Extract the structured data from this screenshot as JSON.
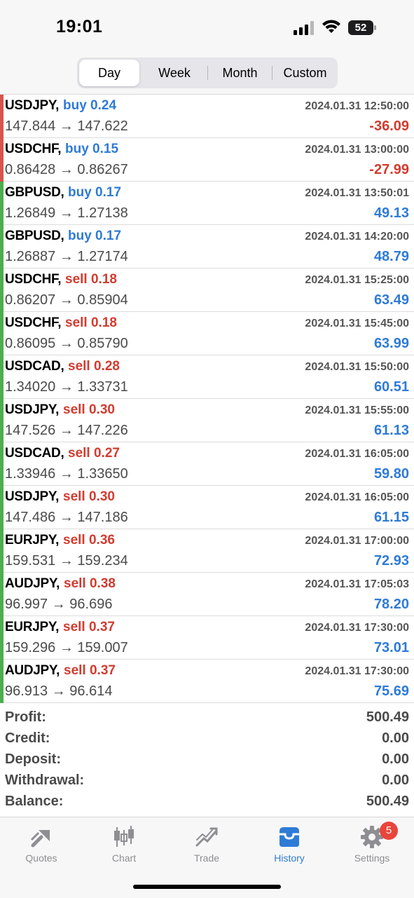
{
  "status": {
    "time": "19:01",
    "battery": "52"
  },
  "segments": [
    "Day",
    "Week",
    "Month",
    "Custom"
  ],
  "trades": [
    {
      "symbol": "USDJPY,",
      "side": "buy 0.24",
      "type": "buy",
      "price": "147.844 → 147.622",
      "time": "2024.01.31 12:50:00",
      "pl": "-36.09",
      "neg": true
    },
    {
      "symbol": "USDCHF,",
      "side": "buy 0.15",
      "type": "buy",
      "price": "0.86428 → 0.86267",
      "time": "2024.01.31 13:00:00",
      "pl": "-27.99",
      "neg": true
    },
    {
      "symbol": "GBPUSD,",
      "side": "buy 0.17",
      "type": "buy",
      "price": "1.26849 → 1.27138",
      "time": "2024.01.31 13:50:01",
      "pl": "49.13",
      "neg": false
    },
    {
      "symbol": "GBPUSD,",
      "side": "buy 0.17",
      "type": "buy",
      "price": "1.26887 → 1.27174",
      "time": "2024.01.31 14:20:00",
      "pl": "48.79",
      "neg": false
    },
    {
      "symbol": "USDCHF,",
      "side": "sell 0.18",
      "type": "sell",
      "price": "0.86207 → 0.85904",
      "time": "2024.01.31 15:25:00",
      "pl": "63.49",
      "neg": false
    },
    {
      "symbol": "USDCHF,",
      "side": "sell 0.18",
      "type": "sell",
      "price": "0.86095 → 0.85790",
      "time": "2024.01.31 15:45:00",
      "pl": "63.99",
      "neg": false
    },
    {
      "symbol": "USDCAD,",
      "side": "sell 0.28",
      "type": "sell",
      "price": "1.34020 → 1.33731",
      "time": "2024.01.31 15:50:00",
      "pl": "60.51",
      "neg": false
    },
    {
      "symbol": "USDJPY,",
      "side": "sell 0.30",
      "type": "sell",
      "price": "147.526 → 147.226",
      "time": "2024.01.31 15:55:00",
      "pl": "61.13",
      "neg": false
    },
    {
      "symbol": "USDCAD,",
      "side": "sell 0.27",
      "type": "sell",
      "price": "1.33946 → 1.33650",
      "time": "2024.01.31 16:05:00",
      "pl": "59.80",
      "neg": false
    },
    {
      "symbol": "USDJPY,",
      "side": "sell 0.30",
      "type": "sell",
      "price": "147.486 → 147.186",
      "time": "2024.01.31 16:05:00",
      "pl": "61.15",
      "neg": false
    },
    {
      "symbol": "EURJPY,",
      "side": "sell 0.36",
      "type": "sell",
      "price": "159.531 → 159.234",
      "time": "2024.01.31 17:00:00",
      "pl": "72.93",
      "neg": false
    },
    {
      "symbol": "AUDJPY,",
      "side": "sell 0.38",
      "type": "sell",
      "price": "96.997 → 96.696",
      "time": "2024.01.31 17:05:03",
      "pl": "78.20",
      "neg": false
    },
    {
      "symbol": "EURJPY,",
      "side": "sell 0.37",
      "type": "sell",
      "price": "159.296 → 159.007",
      "time": "2024.01.31 17:30:00",
      "pl": "73.01",
      "neg": false
    },
    {
      "symbol": "AUDJPY,",
      "side": "sell 0.37",
      "type": "sell",
      "price": "96.913 → 96.614",
      "time": "2024.01.31 17:30:00",
      "pl": "75.69",
      "neg": false
    }
  ],
  "summary": [
    {
      "label": "Profit:",
      "value": "500.49"
    },
    {
      "label": "Credit:",
      "value": "0.00"
    },
    {
      "label": "Deposit:",
      "value": "0.00"
    },
    {
      "label": "Withdrawal:",
      "value": "0.00"
    },
    {
      "label": "Balance:",
      "value": "500.49"
    }
  ],
  "tabs": [
    {
      "label": "Quotes",
      "icon": "quotes-icon"
    },
    {
      "label": "Chart",
      "icon": "chart-icon"
    },
    {
      "label": "Trade",
      "icon": "trade-icon"
    },
    {
      "label": "History",
      "icon": "history-icon"
    },
    {
      "label": "Settings",
      "icon": "settings-icon",
      "badge": "5"
    }
  ],
  "colors": {
    "buy": "#2e7bd6",
    "sell": "#d23b2f",
    "loss_bar": "#d9534f",
    "profit_bar": "#4cae4c",
    "active_tab": "#2e7bd6"
  }
}
